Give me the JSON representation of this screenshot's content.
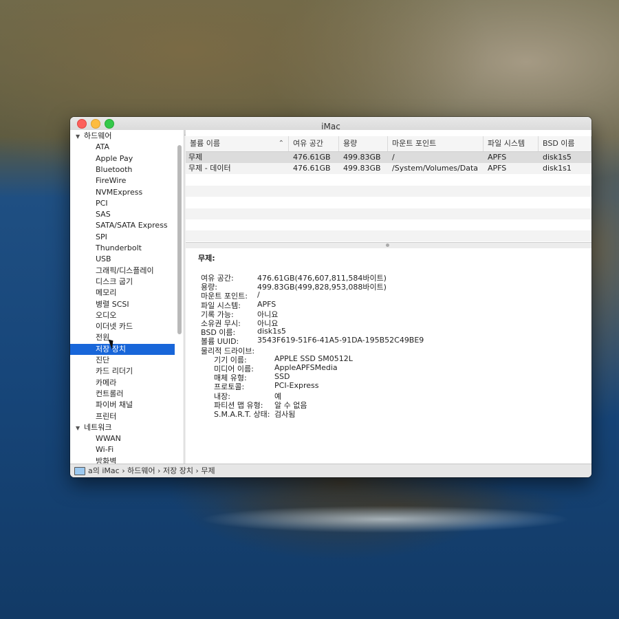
{
  "window": {
    "title": "iMac"
  },
  "sidebar": {
    "groups": [
      {
        "label": "하드웨어"
      },
      {
        "label": "네트워크"
      }
    ],
    "hardware_items": [
      "ATA",
      "Apple Pay",
      "Bluetooth",
      "FireWire",
      "NVMExpress",
      "PCI",
      "SAS",
      "SATA/SATA Express",
      "SPI",
      "Thunderbolt",
      "USB",
      "그래픽/디스플레이",
      "디스크 굽기",
      "메모리",
      "병렬 SCSI",
      "오디오",
      "이더넷 카드",
      "전원",
      "저장 장치",
      "진단",
      "카드 리더기",
      "카메라",
      "컨트롤러",
      "파이버 채널",
      "프린터"
    ],
    "network_items": [
      "WWAN",
      "Wi-Fi",
      "방화벽"
    ],
    "selected": "저장 장치"
  },
  "table": {
    "headers": [
      "볼륨 이름",
      "여유 공간",
      "용량",
      "마운트 포인트",
      "파일 시스템",
      "BSD 이름"
    ],
    "rows": [
      [
        "무제",
        "476.61GB",
        "499.83GB",
        "/",
        "APFS",
        "disk1s5"
      ],
      [
        "무제 - 데이터",
        "476.61GB",
        "499.83GB",
        "/System/Volumes/Data",
        "APFS",
        "disk1s1"
      ]
    ]
  },
  "details": {
    "title": "무제:",
    "fields": [
      {
        "label": "여유 공간:",
        "value": "476.61GB(476,607,811,584바이트)"
      },
      {
        "label": "용량:",
        "value": "499.83GB(499,828,953,088바이트)"
      },
      {
        "label": "마운트 포인트:",
        "value": "/"
      },
      {
        "label": "파일 시스템:",
        "value": "APFS"
      },
      {
        "label": "기록 가능:",
        "value": "아니요"
      },
      {
        "label": "소유권 무시:",
        "value": "아니요"
      },
      {
        "label": "BSD 이름:",
        "value": "disk1s5"
      },
      {
        "label": "볼륨 UUID:",
        "value": "3543F619-51F6-41A5-91DA-195B52C49BE9"
      },
      {
        "label": "물리적 드라이브:",
        "value": ""
      }
    ],
    "drive_fields": [
      {
        "label": "기기 이름:",
        "value": "APPLE SSD SM0512L"
      },
      {
        "label": "미디어 이름:",
        "value": "AppleAPFSMedia"
      },
      {
        "label": "매체 유형:",
        "value": "SSD"
      },
      {
        "label": "프로토콜:",
        "value": "PCI-Express"
      },
      {
        "label": "내장:",
        "value": "예"
      },
      {
        "label": "파티션 맵 유형:",
        "value": "알 수 없음"
      },
      {
        "label": "S.M.A.R.T. 상태:",
        "value": "검사됨"
      }
    ]
  },
  "statusbar": {
    "breadcrumb": "a의 iMac › 하드웨어 › 저장 장치 › 무제"
  }
}
